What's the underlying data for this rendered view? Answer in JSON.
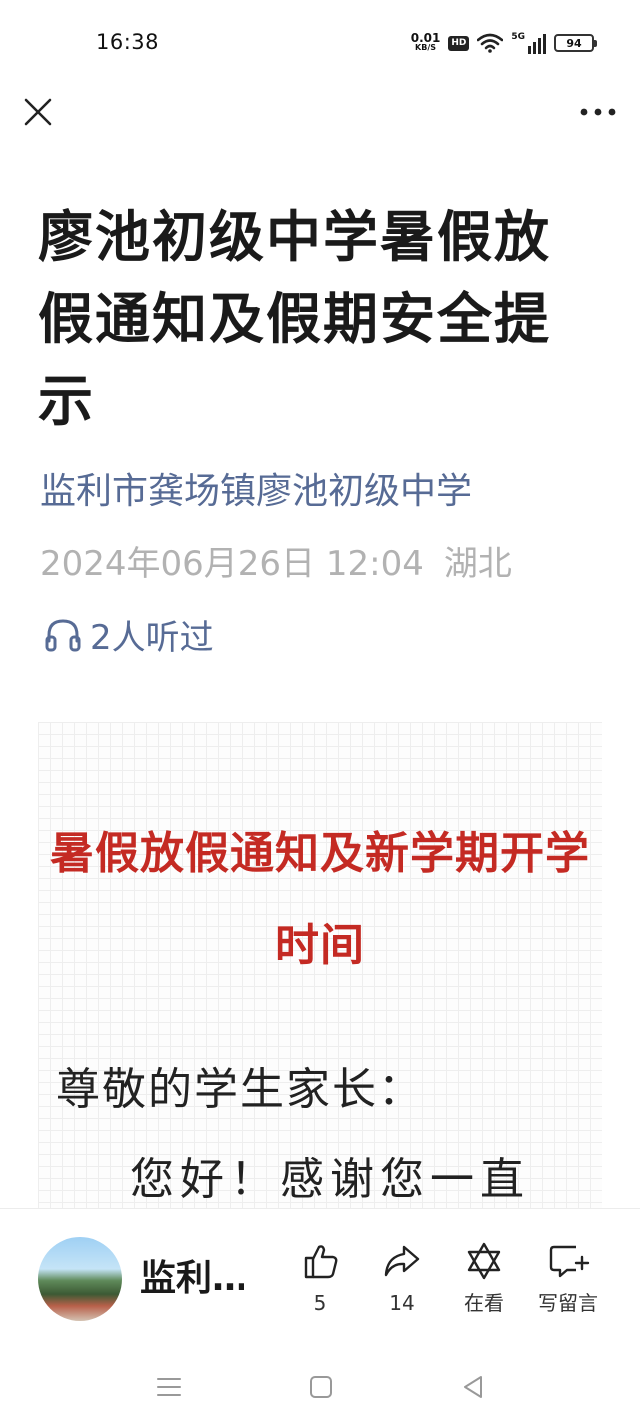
{
  "status_bar": {
    "time": "16:38",
    "net_speed_value": "0.01",
    "net_speed_unit": "KB/S",
    "hd_label": "HD",
    "network_label": "5G",
    "battery": "94"
  },
  "nav": {
    "close_icon": "close-icon",
    "more_icon": "more-icon"
  },
  "article": {
    "title": "廖池初级中学暑假放假通知及假期安全提示",
    "account": "监利市龚场镇廖池初级中学",
    "date": "2024年06月26日 12:04",
    "location": "湖北",
    "listeners": "2人听过"
  },
  "content": {
    "heading": "暑假放假通知及新学期开学时间",
    "greeting": "尊敬的学生家长：",
    "body_line": "您好！感谢您一直"
  },
  "bottom_bar": {
    "author_name": "监利…",
    "like_count": "5",
    "share_count": "14",
    "watching_label": "在看",
    "comment_label": "写留言"
  },
  "colors": {
    "link_blue": "#576b95",
    "heading_red": "#c42a23",
    "meta_gray": "#b2b2b2"
  }
}
